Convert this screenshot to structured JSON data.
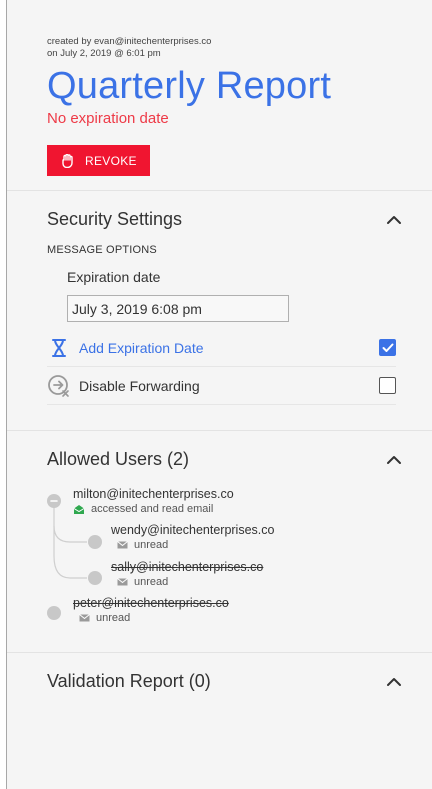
{
  "header": {
    "created_by": "created by evan@initechenterprises.co",
    "created_on": "on July 2, 2019 @ 6:01 pm",
    "title": "Quarterly Report",
    "expiration_status": "No expiration date",
    "revoke_label": "REVOKE"
  },
  "security": {
    "title": "Security Settings",
    "options_label": "MESSAGE OPTIONS",
    "expiration_label": "Expiration date",
    "expiration_value": "July 3, 2019 6:08 pm",
    "add_expiration_label": "Add Expiration Date",
    "add_expiration_checked": true,
    "disable_forwarding_label": "Disable Forwarding",
    "disable_forwarding_checked": false
  },
  "allowed_users": {
    "title": "Allowed Users (2)",
    "users": [
      {
        "email": "milton@initechenterprises.co",
        "status": "accessed and read email",
        "struck": false
      },
      {
        "email": "wendy@initechenterprises.co",
        "status": "unread",
        "struck": false
      },
      {
        "email": "sally@initechenterprises.co",
        "status": "unread",
        "struck": true
      },
      {
        "email": "peter@initechenterprises.co",
        "status": "unread",
        "struck": true
      }
    ]
  },
  "validation": {
    "title": "Validation Report (0)"
  },
  "colors": {
    "accent": "#3b72e6",
    "danger": "#f01530",
    "read_status": "#2fa84f"
  }
}
